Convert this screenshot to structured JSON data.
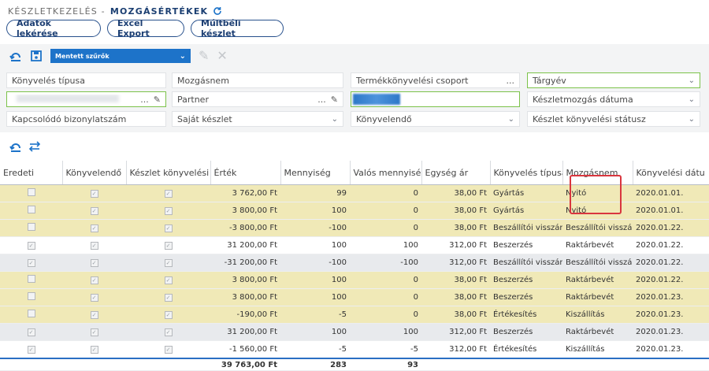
{
  "header": {
    "crumb": "KÉSZLETKEZELÉS -",
    "title": "MOZGÁSÉRTÉKEK"
  },
  "buttons": {
    "fetch": "Adatok lekérése",
    "excel": "Excel Export",
    "past": "Múltbéli készlet"
  },
  "toolbar": {
    "saved_filters": "Mentett szűrők"
  },
  "filters": {
    "konyveles_tipusa": "Könyvelés típusa",
    "mozgasnem": "Mozgásnem",
    "termekkonyvelesi": "Termékkönyvelési csoport",
    "targyev": "Tárgyév",
    "partner": "Partner",
    "keszletmozgas_datuma": "Készletmozgás dátuma",
    "kapcsolodo": "Kapcsolódó bizonylatszám",
    "sajat_keszlet": "Saját készlet",
    "konyvelendo": "Könyvelendő",
    "keszlet_konyvelesi_status": "Készlet könyvelési státusz",
    "dots": "..."
  },
  "table": {
    "columns": [
      "Eredeti",
      "Könyvelendő",
      "Készlet könyvelési s",
      "Érték",
      "Mennyiség",
      "Valós mennyiség",
      "Egység ár",
      "Könyvelés típusa",
      "Mozgásnem",
      "Könyvelési dátu"
    ],
    "rows": [
      {
        "style": "y",
        "ered": false,
        "konyv": true,
        "keszl": true,
        "ertek": "3 762,00 Ft",
        "menny": "99",
        "valos": "0",
        "ar": "38,00 Ft",
        "tipus": "Gyártás",
        "mozg": "Nyitó",
        "datum": "2020.01.01."
      },
      {
        "style": "y",
        "ered": false,
        "konyv": true,
        "keszl": true,
        "ertek": "3 800,00 Ft",
        "menny": "100",
        "valos": "0",
        "ar": "38,00 Ft",
        "tipus": "Gyártás",
        "mozg": "Nyitó",
        "datum": "2020.01.01."
      },
      {
        "style": "y",
        "ered": false,
        "konyv": true,
        "keszl": true,
        "ertek": "-3 800,00 Ft",
        "menny": "-100",
        "valos": "0",
        "ar": "38,00 Ft",
        "tipus": "Beszállítói visszáru",
        "mozg": "Beszállítói visszáru",
        "datum": "2020.01.22."
      },
      {
        "style": "w",
        "ered": true,
        "konyv": true,
        "keszl": true,
        "ertek": "31 200,00 Ft",
        "menny": "100",
        "valos": "100",
        "ar": "312,00 Ft",
        "tipus": "Beszerzés",
        "mozg": "Raktárbevét",
        "datum": "2020.01.22."
      },
      {
        "style": "g",
        "ered": true,
        "konyv": true,
        "keszl": true,
        "ertek": "-31 200,00 Ft",
        "menny": "-100",
        "valos": "-100",
        "ar": "312,00 Ft",
        "tipus": "Beszállítói visszáru",
        "mozg": "Beszállítói visszáru",
        "datum": "2020.01.22."
      },
      {
        "style": "y",
        "ered": false,
        "konyv": true,
        "keszl": true,
        "ertek": "3 800,00 Ft",
        "menny": "100",
        "valos": "0",
        "ar": "38,00 Ft",
        "tipus": "Beszerzés",
        "mozg": "Raktárbevét",
        "datum": "2020.01.22."
      },
      {
        "style": "y",
        "ered": false,
        "konyv": true,
        "keszl": true,
        "ertek": "3 800,00 Ft",
        "menny": "100",
        "valos": "0",
        "ar": "38,00 Ft",
        "tipus": "Beszerzés",
        "mozg": "Raktárbevét",
        "datum": "2020.01.23."
      },
      {
        "style": "y",
        "ered": false,
        "konyv": true,
        "keszl": true,
        "ertek": "-190,00 Ft",
        "menny": "-5",
        "valos": "0",
        "ar": "38,00 Ft",
        "tipus": "Értékesítés",
        "mozg": "Kiszállítás",
        "datum": "2020.01.23."
      },
      {
        "style": "g",
        "ered": true,
        "konyv": true,
        "keszl": true,
        "ertek": "31 200,00 Ft",
        "menny": "100",
        "valos": "100",
        "ar": "312,00 Ft",
        "tipus": "Beszerzés",
        "mozg": "Raktárbevét",
        "datum": "2020.01.23."
      },
      {
        "style": "w",
        "ered": true,
        "konyv": true,
        "keszl": true,
        "ertek": "-1 560,00 Ft",
        "menny": "-5",
        "valos": "-5",
        "ar": "312,00 Ft",
        "tipus": "Értékesítés",
        "mozg": "Kiszállítás",
        "datum": "2020.01.23."
      }
    ],
    "totals": {
      "ertek": "39 763,00 Ft",
      "menny": "283",
      "valos": "93"
    }
  },
  "colors": {
    "accent": "#1d73c9",
    "row_yellow": "#f0e9b7",
    "row_gray": "#e8eaed",
    "highlight": "#d9363e"
  }
}
